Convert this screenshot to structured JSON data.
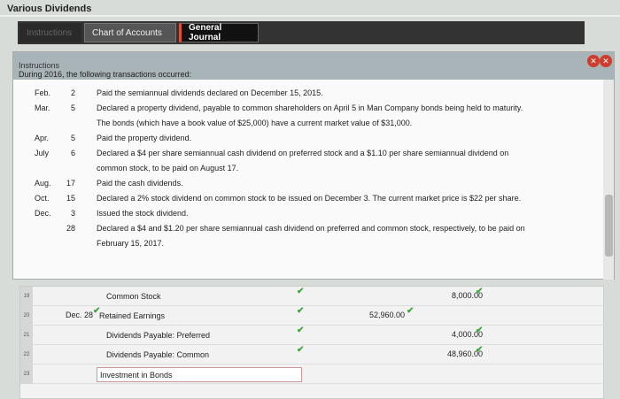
{
  "app": {
    "title": "Various Dividends"
  },
  "tabs": [
    {
      "label": "Instructions"
    },
    {
      "label": "Chart of Accounts"
    },
    {
      "label": "General Journal"
    }
  ],
  "panel": {
    "title": "Instructions",
    "intro": "During 2016, the following transactions occurred:",
    "transactions": [
      {
        "month": "Feb.",
        "day": "2",
        "text": "Paid the semiannual dividends declared on December 15, 2015."
      },
      {
        "month": "Mar.",
        "day": "5",
        "text": "Declared a property dividend, payable to common shareholders on April 5 in Man Company bonds being held to maturity."
      },
      {
        "month": "",
        "day": "",
        "text": "The bonds (which have a book value of $25,000) have a current market value of $31,000."
      },
      {
        "month": "Apr.",
        "day": "5",
        "text": "Paid the property dividend."
      },
      {
        "month": "July",
        "day": "6",
        "text": "Declared a $4 per share semiannual cash dividend on preferred stock and a $1.10 per share semiannual dividend on"
      },
      {
        "month": "",
        "day": "",
        "text": "common stock, to be paid on August 17."
      },
      {
        "month": "Aug.",
        "day": "17",
        "text": "Paid the cash dividends."
      },
      {
        "month": "Oct.",
        "day": "15",
        "text": "Declared a 2% stock dividend on common stock to be issued on December 3. The current market price is $22 per share."
      },
      {
        "month": "Dec.",
        "day": "3",
        "text": "Issued the stock dividend."
      },
      {
        "month": "",
        "day": "28",
        "text": "Declared a $4 and $1.20 per share semiannual cash dividend on preferred and common stock, respectively, to be paid on"
      },
      {
        "month": "",
        "day": "",
        "text": "February 15, 2017."
      }
    ]
  },
  "journal": {
    "rows": [
      {
        "num": "19",
        "date": "",
        "account": "Common Stock",
        "debit": "",
        "credit": "8,000.00"
      },
      {
        "num": "20",
        "date": "Dec. 28",
        "account": "Retained Earnings",
        "debit": "52,960.00",
        "credit": ""
      },
      {
        "num": "21",
        "date": "",
        "account": "Dividends Payable: Preferred",
        "debit": "",
        "credit": "4,000.00"
      },
      {
        "num": "22",
        "date": "",
        "account": "Dividends Payable: Common",
        "debit": "",
        "credit": "48,960.00"
      },
      {
        "num": "23",
        "date": "",
        "account": "Investment in Bonds",
        "debit": "",
        "credit": ""
      }
    ]
  }
}
